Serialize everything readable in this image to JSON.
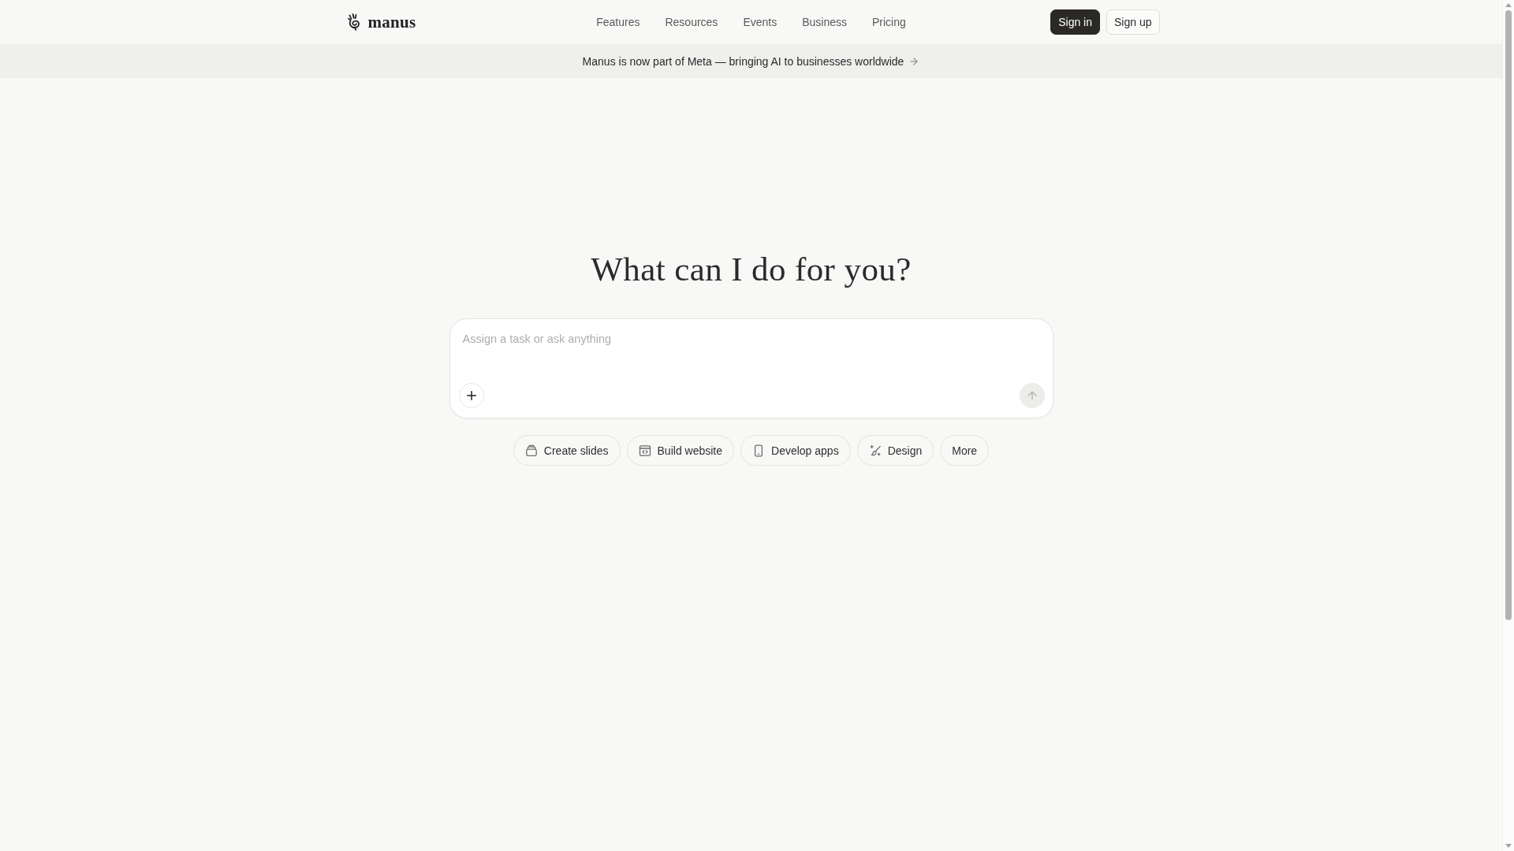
{
  "header": {
    "logo": {
      "text": "manus"
    },
    "nav": [
      "Features",
      "Resources",
      "Events",
      "Business",
      "Pricing"
    ],
    "actions": [
      {
        "label": "Sign in",
        "kind": "primary"
      },
      {
        "label": "Sign up",
        "kind": "outline"
      }
    ]
  },
  "banner": {
    "text": "Manus is now part of Meta — bringing AI to businesses worldwide"
  },
  "hero": {
    "title": "What can I do for you?"
  },
  "composer": {
    "placeholder": "Assign a task or ask anything",
    "send_disabled": true
  },
  "suggestions": [
    {
      "label": "Create slides",
      "kind": "slides"
    },
    {
      "label": "Build website",
      "kind": "website"
    },
    {
      "label": "Develop apps",
      "kind": "apps"
    },
    {
      "label": "Design",
      "kind": "design"
    },
    {
      "label": "More",
      "kind": "more"
    }
  ]
}
